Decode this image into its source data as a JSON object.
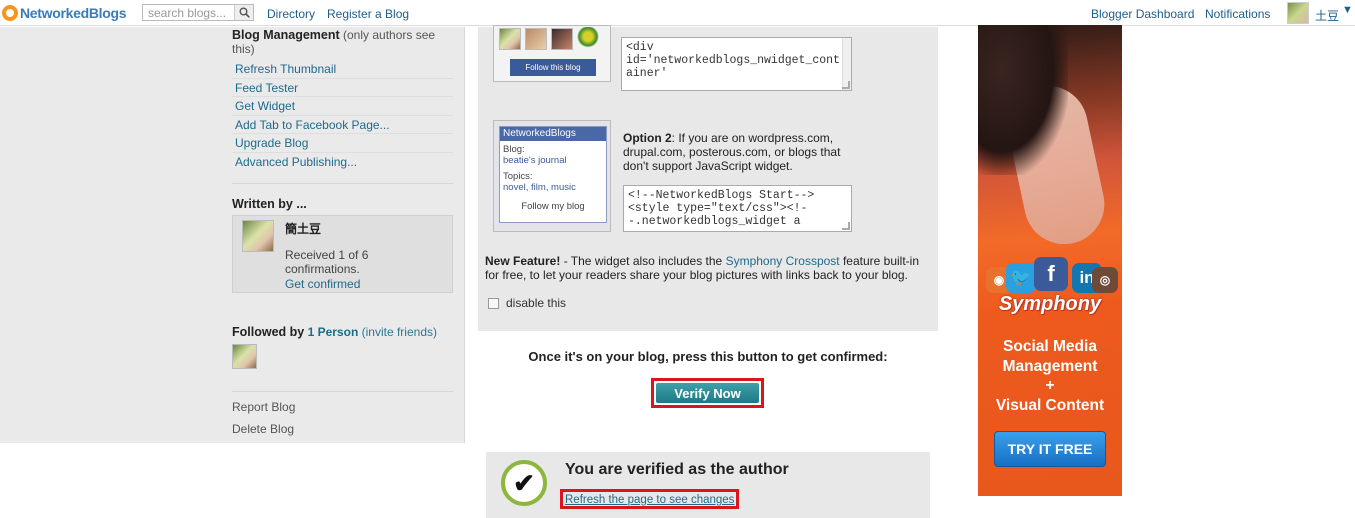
{
  "topbar": {
    "brand_prefix": "",
    "brand": "NetworkedBlogs",
    "search_placeholder": "search blogs...",
    "links": [
      "Directory",
      "Register a Blog"
    ],
    "right_links": [
      "Blogger Dashboard",
      "Notifications"
    ],
    "user_name": "土豆",
    "caret": "▼"
  },
  "sidebar": {
    "blog_mgmt_title": "Blog Management",
    "blog_mgmt_sub": "(only authors see this)",
    "items": [
      "Refresh Thumbnail",
      "Feed Tester",
      "Get Widget",
      "Add Tab to Facebook Page...",
      "Upgrade Blog",
      "Advanced Publishing..."
    ],
    "written_by_title": "Written by ...",
    "author_name": "簡土豆",
    "received_text": "Received 1 of 6 confirmations.",
    "get_confirmed": "Get confirmed",
    "followed_by_prefix": "Followed by",
    "followed_count": "1 Person",
    "invite_friends": "(invite friends)",
    "report_blog": "Report Blog",
    "delete_blog": "Delete Blog"
  },
  "widget1": {
    "follow_button": "Follow this blog",
    "code_lines": [
      "<div",
      "id='networkedblogs_nwidget_cont",
      "ainer'",
      "  "
    ]
  },
  "widget2": {
    "header": "NetworkedBlogs",
    "blog_label": "Blog:",
    "blog_name": "beatie's journal",
    "topics_label": "Topics:",
    "topics": "novel, film, music",
    "follow": "Follow my blog",
    "option_label": "Option 2",
    "option_text": ": If you are on wordpress.com, drupal.com, posterous.com, or blogs that don't support JavaScript widget.",
    "code_lines": [
      "<!--NetworkedBlogs Start-->",
      "<style type=\"text/css\"><!-",
      "-.networkedblogs_widget a"
    ]
  },
  "feature": {
    "label": "New Feature!",
    "text_before": " - The widget also includes the ",
    "link": "Symphony Crosspost",
    "text_after": " feature built-in for free, to let your readers share your blog pictures with links back to your blog.",
    "checkbox_label": "disable this"
  },
  "confirm": {
    "text": "Once it's on your blog, press this button to get confirmed:",
    "button": "Verify Now"
  },
  "verified": {
    "title": "You are verified as the author",
    "refresh_link": "Refresh the page to see changes",
    "check_glyph": "✔"
  },
  "ad": {
    "brand": "Symphony",
    "copy_lines": [
      "Social Media",
      "Management",
      "+",
      "Visual Content"
    ],
    "cta": "TRY IT FREE",
    "icons": [
      "rss-icon",
      "twitter-icon",
      "facebook-icon",
      "linkedin-icon",
      "instagram-icon"
    ]
  },
  "colors": {
    "link": "#1f6a8a",
    "verify_button": "#1c7b86",
    "highlight_red": "#d9161e",
    "check_green": "#8db73c",
    "ad_orange": "#ee5a1e"
  }
}
